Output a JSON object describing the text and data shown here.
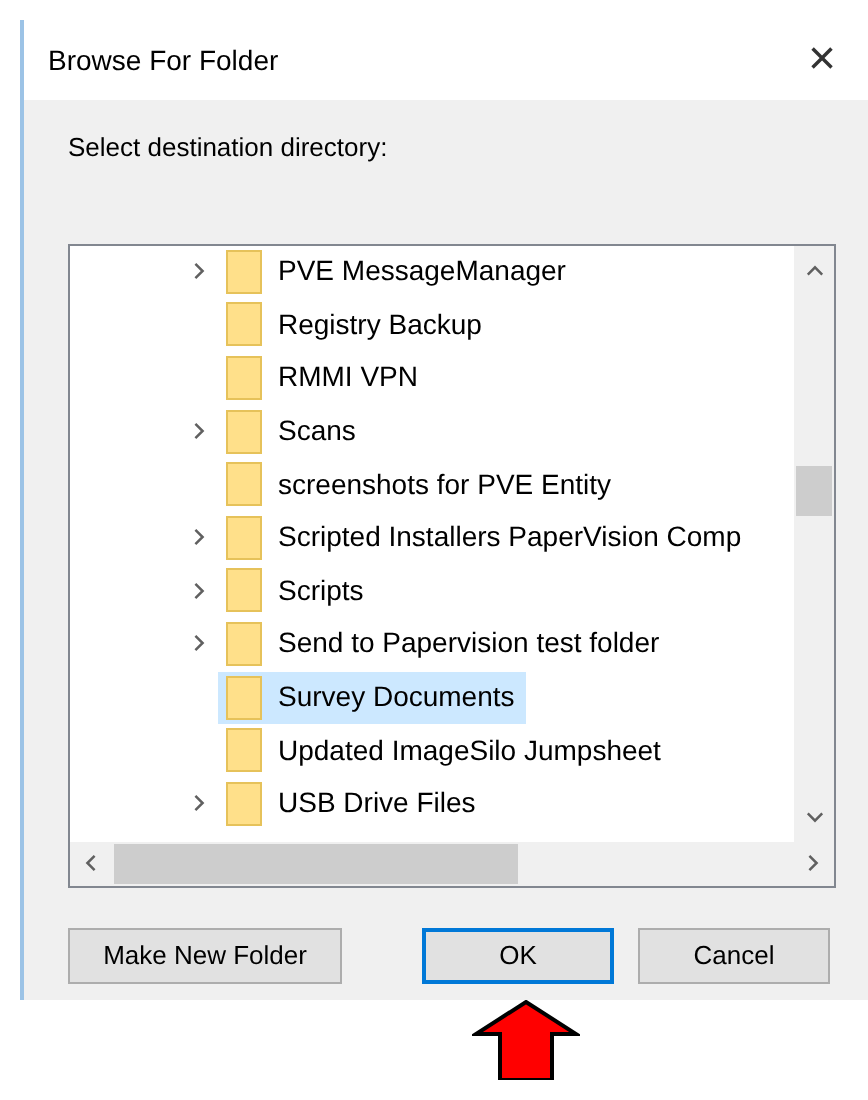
{
  "window": {
    "title": "Browse For Folder",
    "close": "×"
  },
  "prompt": "Select destination directory:",
  "tree": {
    "items": [
      {
        "label": "PVE MessageManager",
        "expandable": true,
        "selected": false
      },
      {
        "label": "Registry Backup",
        "expandable": false,
        "selected": false
      },
      {
        "label": "RMMI VPN",
        "expandable": false,
        "selected": false
      },
      {
        "label": "Scans",
        "expandable": true,
        "selected": false
      },
      {
        "label": "screenshots for PVE Entity",
        "expandable": false,
        "selected": false
      },
      {
        "label": "Scripted Installers PaperVision Comp",
        "expandable": true,
        "selected": false
      },
      {
        "label": "Scripts",
        "expandable": true,
        "selected": false
      },
      {
        "label": "Send to Papervision test folder",
        "expandable": true,
        "selected": false
      },
      {
        "label": "Survey Documents",
        "expandable": false,
        "selected": true
      },
      {
        "label": "Updated ImageSilo Jumpsheet",
        "expandable": false,
        "selected": false
      },
      {
        "label": "USB Drive Files",
        "expandable": true,
        "selected": false
      }
    ]
  },
  "buttons": [
    {
      "label": "Make New Folder",
      "default": false
    },
    {
      "label": "OK",
      "default": true
    },
    {
      "label": "Cancel",
      "default": false
    }
  ]
}
